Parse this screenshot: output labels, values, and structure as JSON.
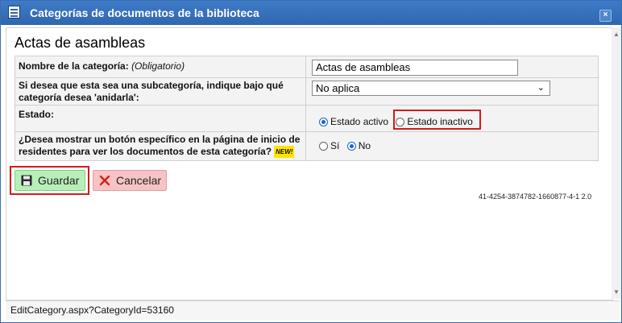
{
  "window": {
    "title": "Categorías de documentos de la biblioteca",
    "close_label": "×"
  },
  "page": {
    "heading": "Actas de asambleas"
  },
  "form": {
    "name": {
      "label": "Nombre de la categoría:",
      "hint": "(Obligatorio)",
      "value": "Actas de asambleas"
    },
    "parent": {
      "label": "Si desea que esta sea una subcategoría, indique bajo qué categoría desea 'anidarla':",
      "selected": "No aplica"
    },
    "status": {
      "label": "Estado:",
      "options": [
        {
          "label": "Estado activo",
          "checked": true
        },
        {
          "label": "Estado inactivo",
          "checked": false
        }
      ]
    },
    "show_button": {
      "label": "¿Desea mostrar un botón específico en la página de inicio de residentes para ver los documentos de esta categoría?",
      "badge": "NEW!",
      "options": [
        {
          "label": "Sí",
          "checked": false
        },
        {
          "label": "No",
          "checked": true
        }
      ]
    }
  },
  "actions": {
    "save_label": "Guardar",
    "cancel_label": "Cancelar"
  },
  "version": "41-4254-3874782-1660877-4-1 2.0",
  "status_bar": "EditCategory.aspx?CategoryId=53160",
  "colors": {
    "titlebar": "#2f66b0",
    "highlight": "#d21b1b",
    "save_bg": "#b8efb8",
    "cancel_bg": "#f6c4c4",
    "radio_checked": "#1a66d2"
  },
  "icons": [
    "list-icon",
    "close-icon",
    "save-icon",
    "x-icon",
    "chevron-down-icon"
  ]
}
